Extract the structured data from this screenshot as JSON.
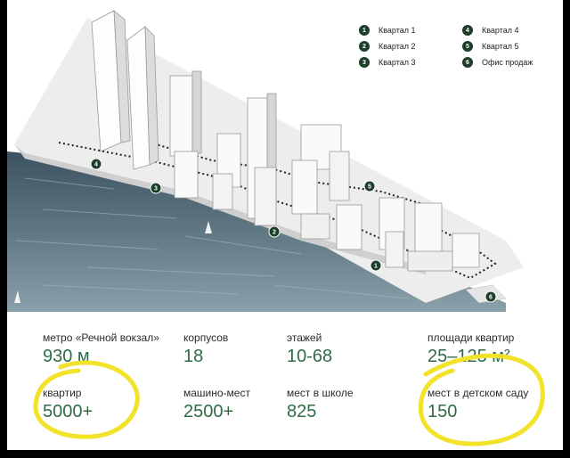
{
  "legend": [
    {
      "num": "1",
      "label": "Квартал 1"
    },
    {
      "num": "2",
      "label": "Квартал 2"
    },
    {
      "num": "3",
      "label": "Квартал 3"
    },
    {
      "num": "4",
      "label": "Квартал 4"
    },
    {
      "num": "5",
      "label": "Квартал 5"
    },
    {
      "num": "6",
      "label": "Офис продаж"
    }
  ],
  "map_markers": [
    "1",
    "2",
    "3",
    "4",
    "5",
    "6"
  ],
  "stats": [
    {
      "label": "метро «Речной вокзал»",
      "value": "930 м"
    },
    {
      "label": "корпусов",
      "value": "18"
    },
    {
      "label": "этажей",
      "value": "10-68"
    },
    {
      "label": "площади квартир",
      "value": "25–125 м²"
    },
    {
      "label": "квартир",
      "value": "5000+"
    },
    {
      "label": "машино-мест",
      "value": "2500+"
    },
    {
      "label": "мест в школе",
      "value": "825"
    },
    {
      "label": "мест в детском саду",
      "value": "150"
    }
  ],
  "colors": {
    "accent_green": "#2f6b46",
    "marker_dark_green": "#1d3f2a",
    "highlight_yellow": "#f2e22a",
    "water": "#4d6473"
  }
}
